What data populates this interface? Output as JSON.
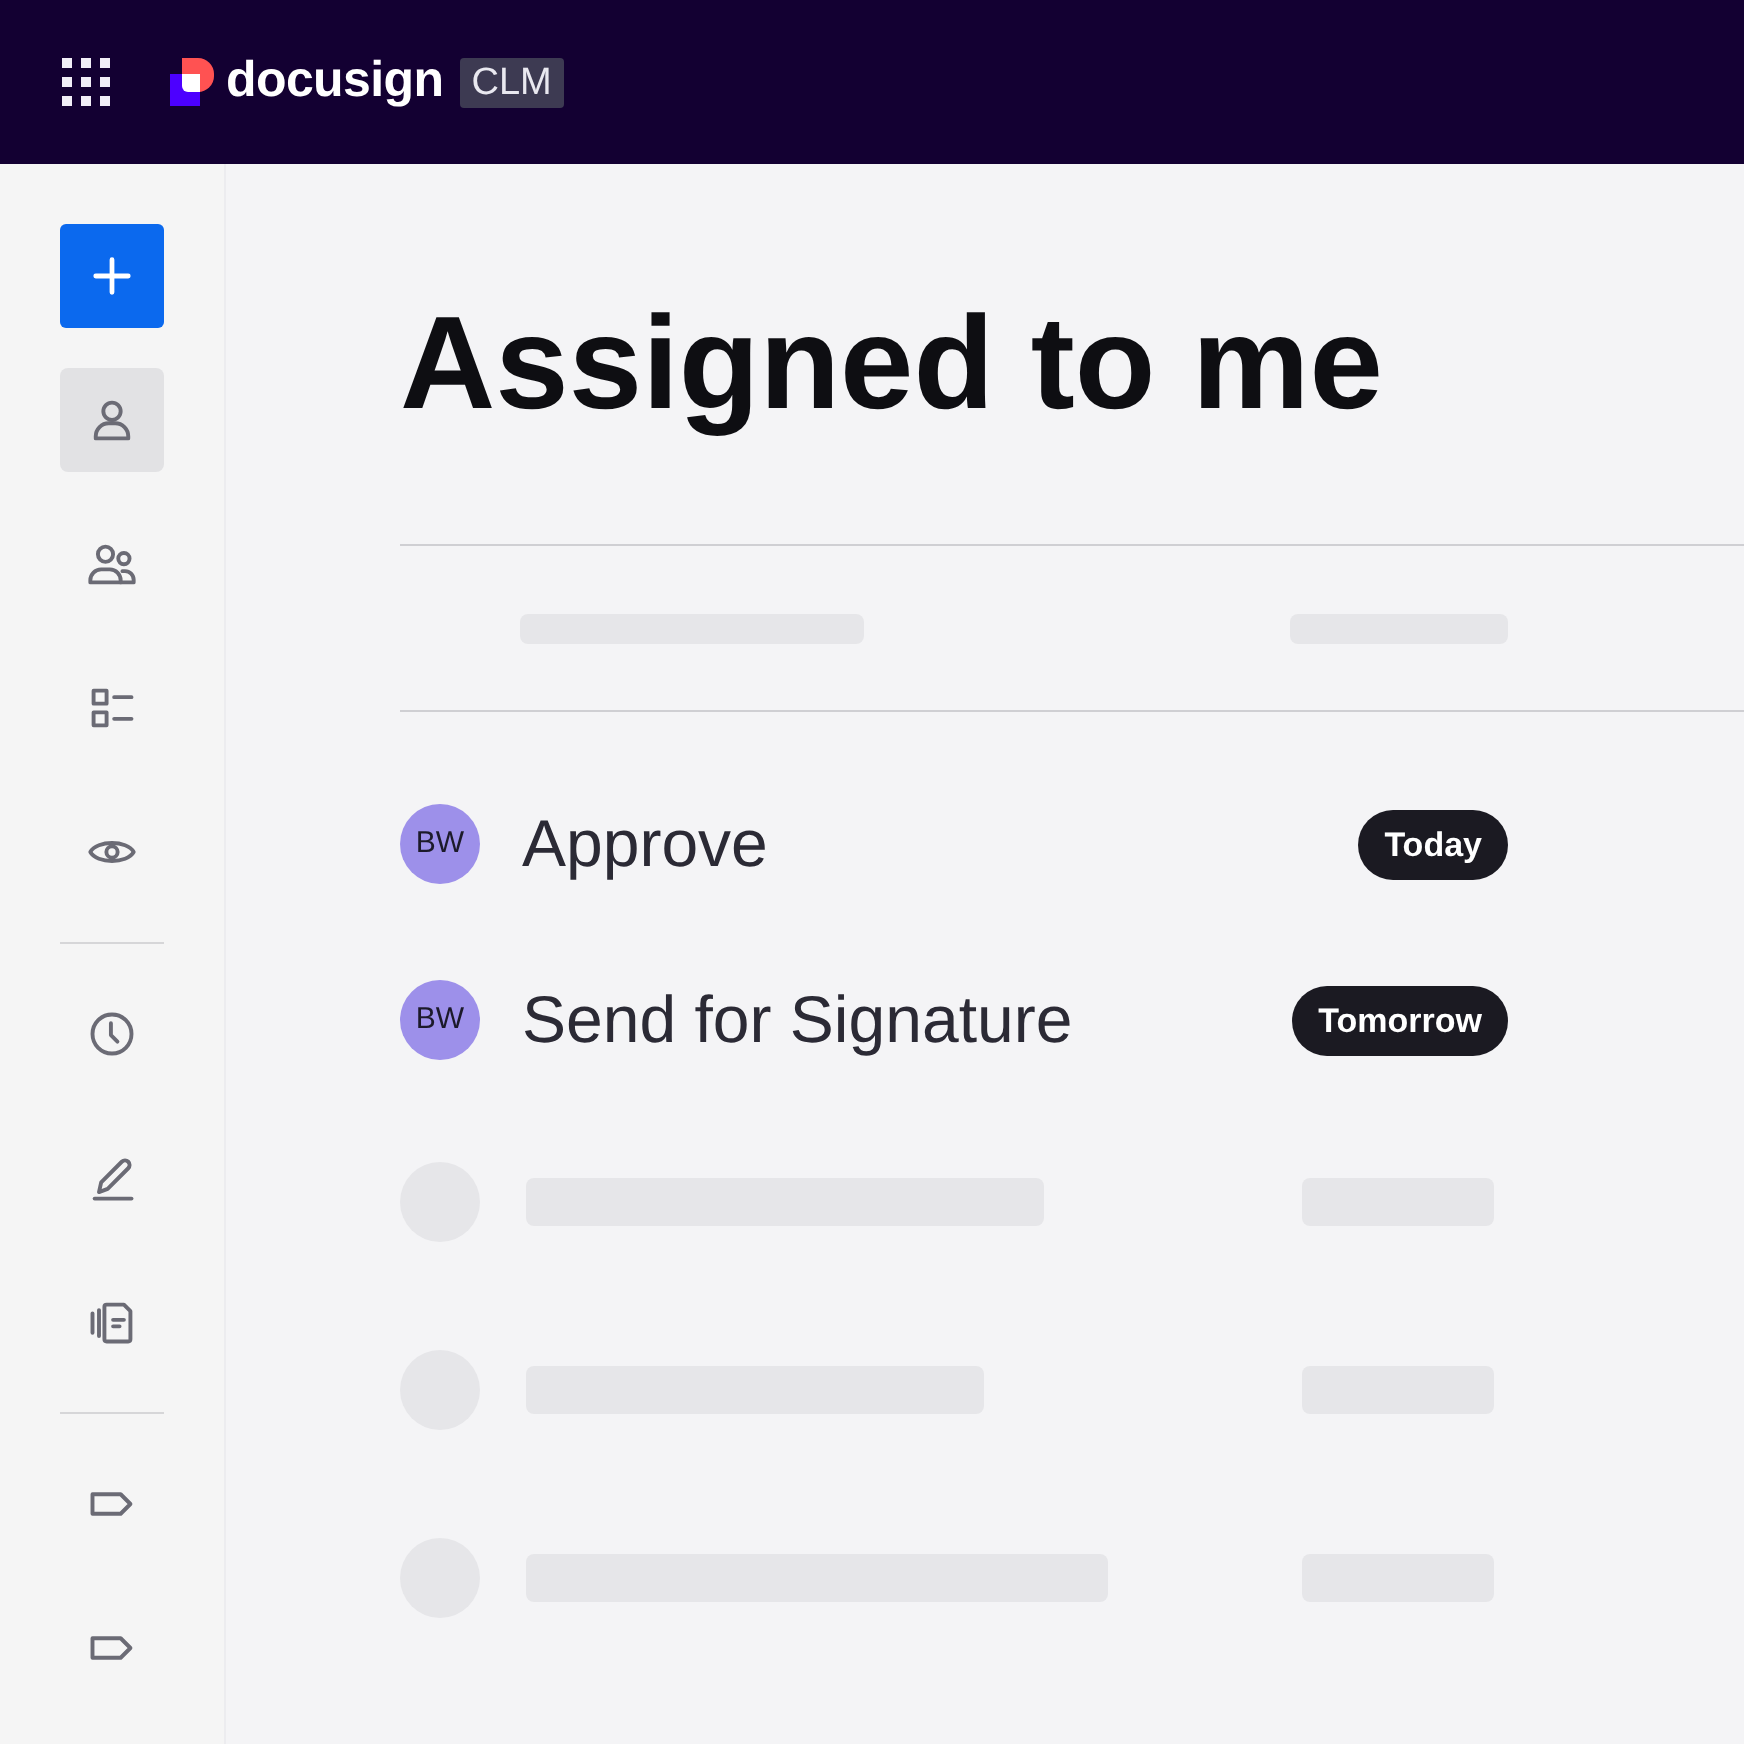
{
  "topbar": {
    "brand": "docusign",
    "product": "CLM"
  },
  "sidebar": {
    "items": [
      {
        "kind": "create"
      },
      {
        "kind": "nav",
        "selected": true
      },
      {
        "kind": "nav",
        "selected": false
      },
      {
        "kind": "nav",
        "selected": false
      },
      {
        "kind": "nav",
        "selected": false
      },
      {
        "kind": "divider"
      },
      {
        "kind": "nav",
        "selected": false
      },
      {
        "kind": "nav",
        "selected": false
      },
      {
        "kind": "nav",
        "selected": false
      },
      {
        "kind": "divider"
      },
      {
        "kind": "nav",
        "selected": false
      },
      {
        "kind": "nav",
        "selected": false
      }
    ]
  },
  "page": {
    "title": "Assigned to me"
  },
  "table": {
    "columns": [
      {
        "kind": "placeholder"
      },
      {
        "kind": "placeholder"
      }
    ],
    "rows": [
      {
        "kind": "task",
        "initials": "BW",
        "name": "Approve",
        "due": "Today"
      },
      {
        "kind": "task",
        "initials": "BW",
        "name": "Send for Signature",
        "due": "Tomorrow"
      },
      {
        "kind": "placeholder"
      },
      {
        "kind": "placeholder"
      },
      {
        "kind": "placeholder"
      }
    ]
  }
}
